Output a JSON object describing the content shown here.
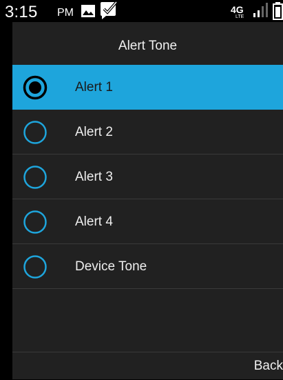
{
  "status_bar": {
    "time": "3:15",
    "ampm": "PM",
    "icons": [
      "gallery-icon",
      "message-check-icon",
      "network-4g-lte-icon",
      "signal-icon",
      "battery-icon"
    ]
  },
  "screen": {
    "title": "Alert Tone"
  },
  "options": [
    {
      "label": "Alert 1",
      "selected": true
    },
    {
      "label": "Alert 2",
      "selected": false
    },
    {
      "label": "Alert 3",
      "selected": false
    },
    {
      "label": "Alert 4",
      "selected": false
    },
    {
      "label": "Device Tone",
      "selected": false
    }
  ],
  "softkeys": {
    "right": "Back"
  },
  "colors": {
    "accent": "#1ea5dc",
    "background": "#212121",
    "statusbar": "#000000"
  }
}
